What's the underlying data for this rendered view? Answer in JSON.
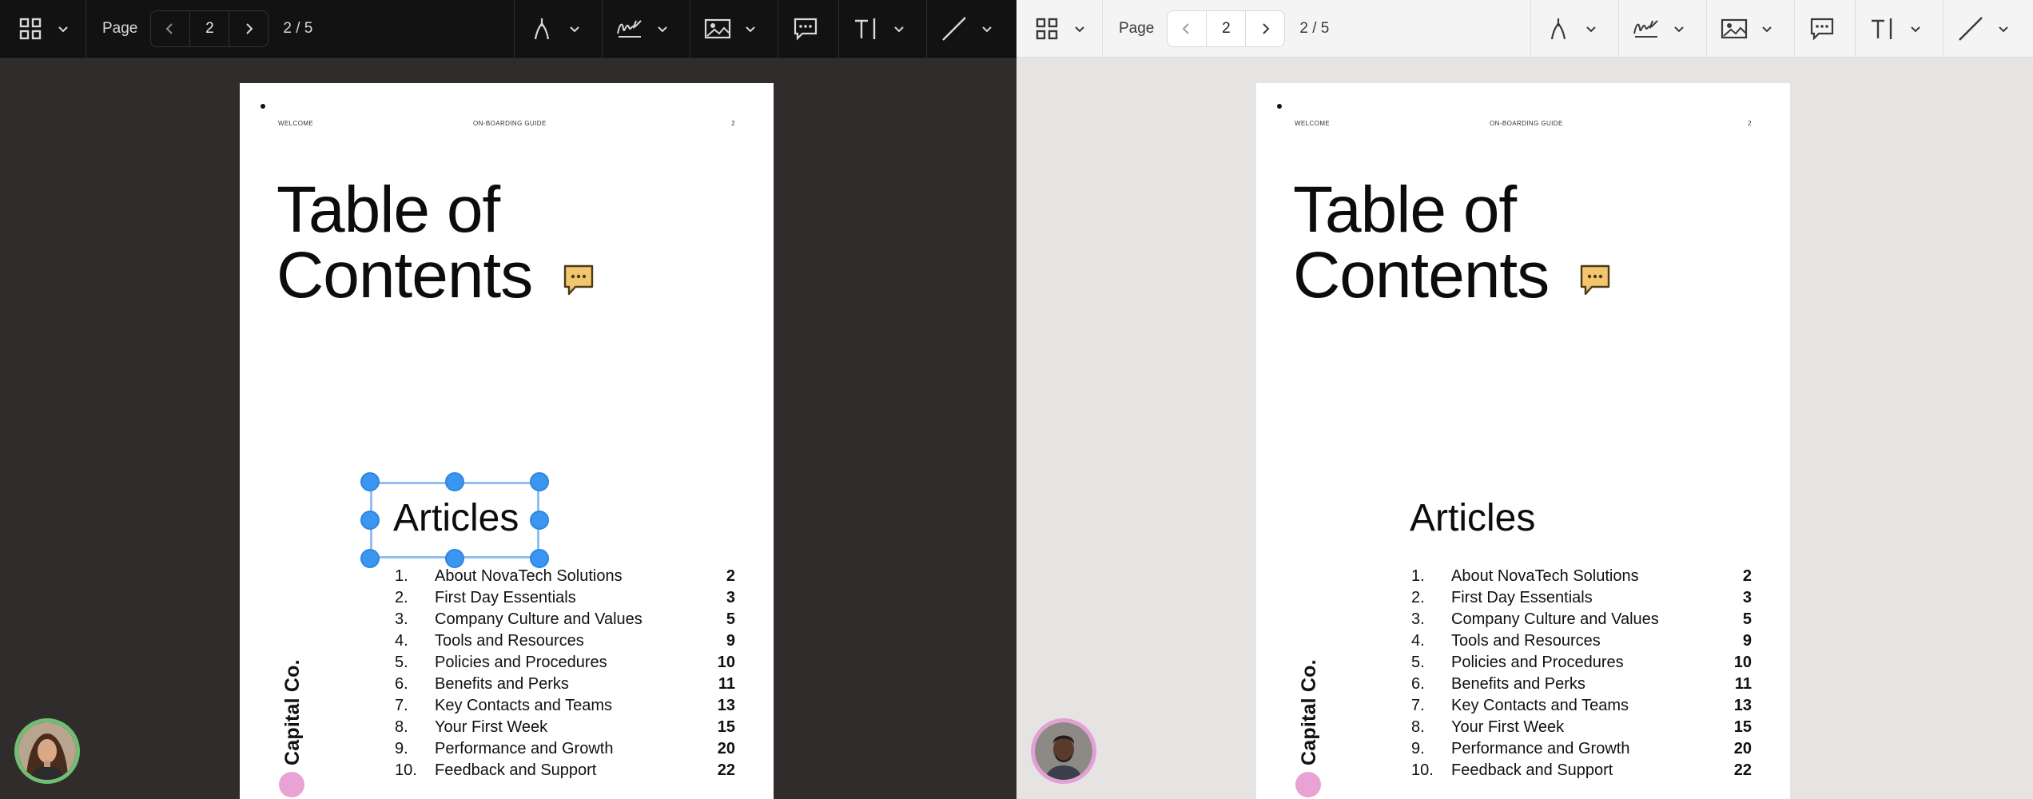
{
  "colors": {
    "selection_handle": "#3a96f0",
    "selection_border": "#8fc0f2",
    "comment_note": "#f2c66d",
    "brand_dot": "#e8a2d4",
    "avatar_left_ring": "#6fbf73",
    "avatar_right_ring": "#e3a0d5",
    "left_theme_background": "#302c2c",
    "right_theme_background": "#e5e4e2"
  },
  "toolbar": {
    "grid_icon": "grid-icon",
    "page_label": "Page",
    "current_page": "2",
    "page_count": "2 / 5",
    "tools": [
      {
        "name": "pen",
        "icon": "pen-icon"
      },
      {
        "name": "signature",
        "icon": "signature-icon"
      },
      {
        "name": "image",
        "icon": "image-icon"
      },
      {
        "name": "comment",
        "icon": "comment-icon"
      },
      {
        "name": "text",
        "icon": "text-icon"
      },
      {
        "name": "line",
        "icon": "line-icon"
      }
    ]
  },
  "document": {
    "header_left": "WELCOME",
    "header_center": "ON-BOARDING GUIDE",
    "header_right": "2",
    "title_line1": "Table of",
    "title_line2": "Contents",
    "section_title": "Articles",
    "brand": "Capital Co.",
    "toc": [
      {
        "num": "1.",
        "title": "About NovaTech Solutions",
        "page": "2"
      },
      {
        "num": "2.",
        "title": "First Day Essentials",
        "page": "3"
      },
      {
        "num": "3.",
        "title": "Company Culture and Values",
        "page": "5"
      },
      {
        "num": "4.",
        "title": "Tools and Resources",
        "page": "9"
      },
      {
        "num": "5.",
        "title": "Policies and Procedures",
        "page": "10"
      },
      {
        "num": "6.",
        "title": "Benefits and Perks",
        "page": "11"
      },
      {
        "num": "7.",
        "title": "Key Contacts and Teams",
        "page": "13"
      },
      {
        "num": "8.",
        "title": "Your First Week",
        "page": "15"
      },
      {
        "num": "9.",
        "title": "Performance and Growth",
        "page": "20"
      },
      {
        "num": "10.",
        "title": "Feedback and Support",
        "page": "22"
      }
    ]
  },
  "panels": [
    {
      "theme": "dark",
      "avatar": "user-avatar-woman",
      "selection_visible": true
    },
    {
      "theme": "light",
      "avatar": "user-avatar-man",
      "selection_visible": false
    }
  ]
}
